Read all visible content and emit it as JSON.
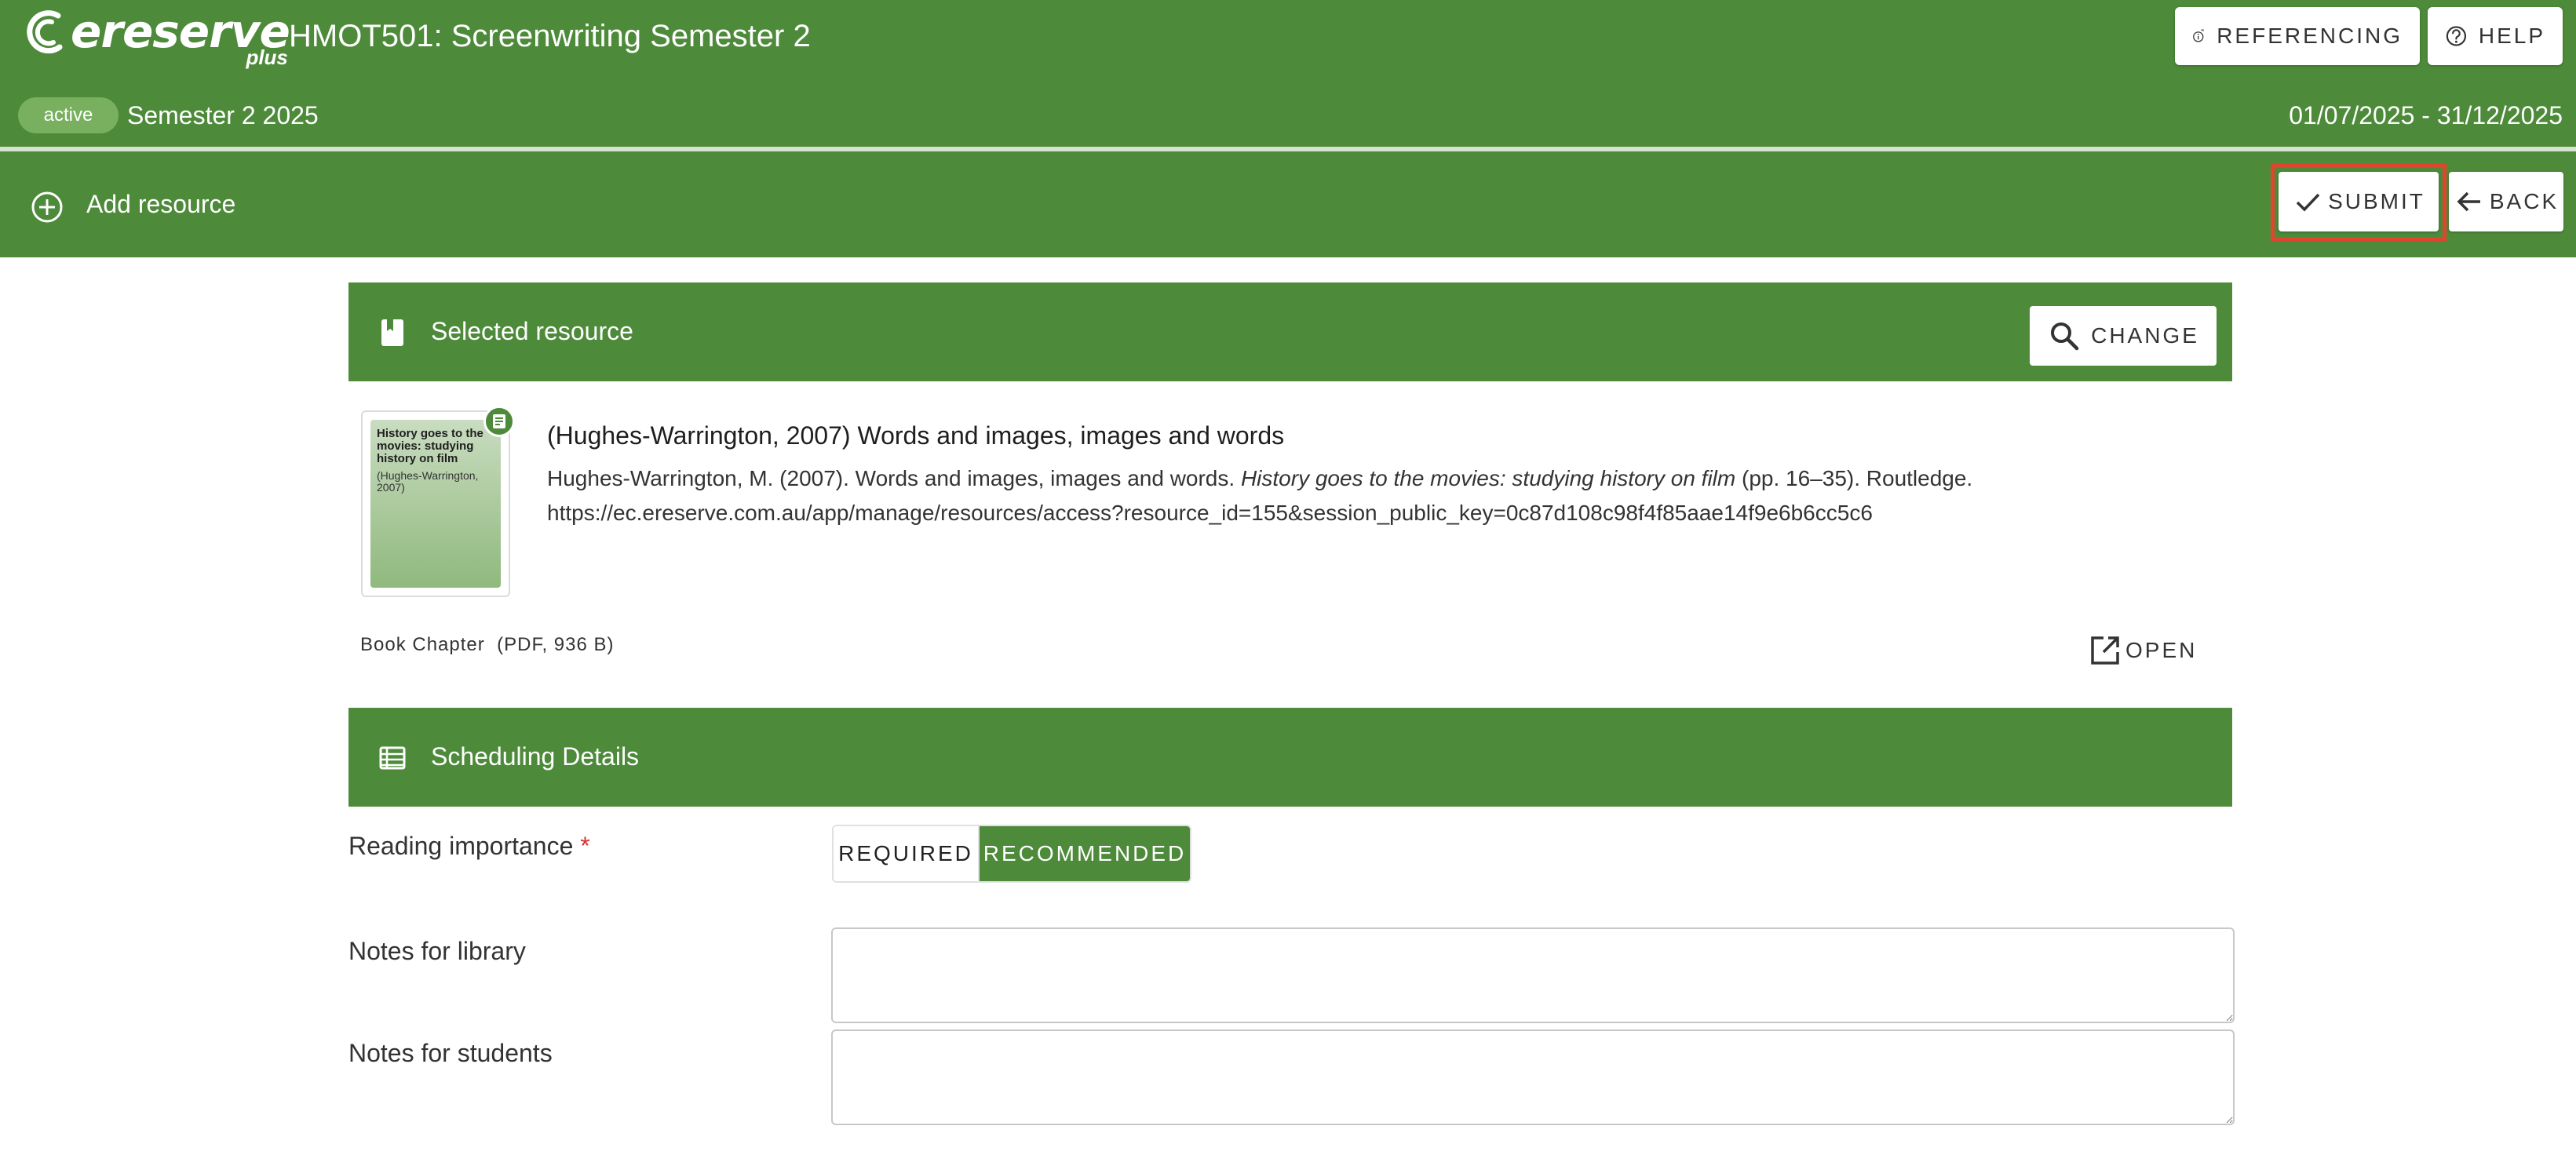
{
  "header": {
    "logo_text": "ereserve",
    "logo_subtext": "plus",
    "course_title": "HMOT501: Screenwriting Semester 2",
    "referencing_label": "REFERENCING",
    "help_label": "HELP",
    "status_badge": "active",
    "semester": "Semester 2 2025",
    "date_range": "01/07/2025 - 31/12/2025"
  },
  "actionbar": {
    "title": "Add resource",
    "submit_label": "SUBMIT",
    "back_label": "BACK"
  },
  "selected_resource": {
    "section_title": "Selected resource",
    "change_label": "CHANGE",
    "thumbnail_title": "History goes to the movies: studying history on film",
    "thumbnail_author": "(Hughes-Warrington, 2007)",
    "heading": "(Hughes-Warrington, 2007) Words and images, images and words",
    "citation_prefix": "Hughes-Warrington, M. (2007). Words and images, images and words. ",
    "citation_title": "History goes to the movies: studying history on film",
    "citation_suffix": " (pp. 16–35). Routledge.",
    "url": "https://ec.ereserve.com.au/app/manage/resources/access?resource_id=155&session_public_key=0c87d108c98f4f85aae14f9e6b6cc5c6",
    "type": "Book Chapter",
    "file_info": "(PDF, 936 B)",
    "open_label": "OPEN"
  },
  "scheduling": {
    "section_title": "Scheduling Details",
    "reading_importance_label": "Reading importance",
    "required_marker": "*",
    "options": [
      "REQUIRED",
      "RECOMMENDED"
    ],
    "selected_option": "RECOMMENDED",
    "notes_library_label": "Notes for library",
    "notes_library_value": "",
    "notes_students_label": "Notes for students",
    "notes_students_value": ""
  },
  "colors": {
    "brand_green": "#4d8a3a",
    "highlight_red": "#e0452e",
    "required_red": "#d32f2f"
  }
}
